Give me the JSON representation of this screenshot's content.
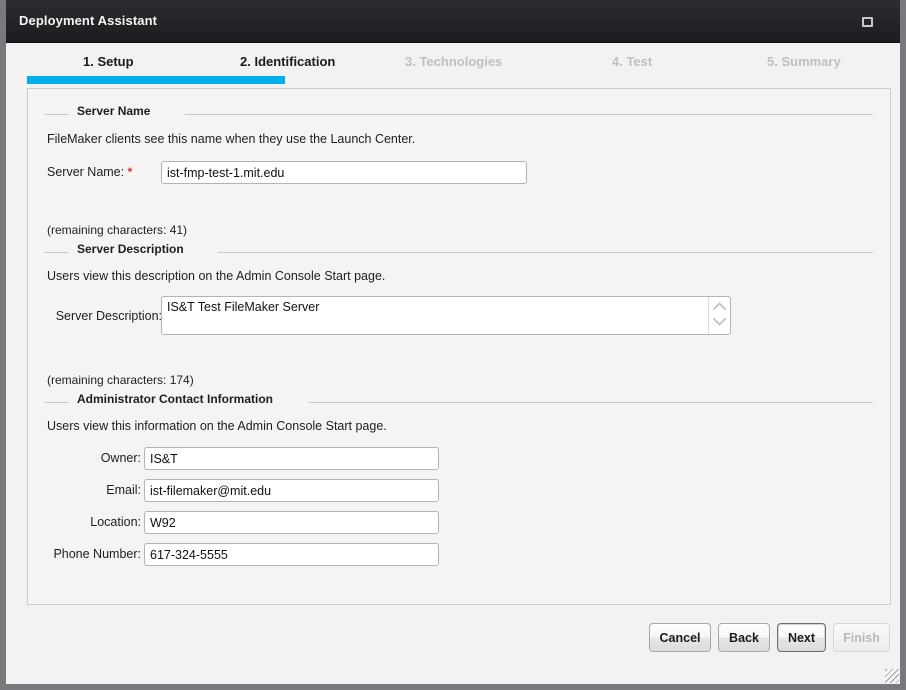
{
  "window": {
    "title": "Deployment Assistant",
    "maximize_icon": "maximize-box-icon",
    "resize_grip_icon": "resize-grip-icon",
    "accent_color": "#00b0e8",
    "titlebar_color": "#232528"
  },
  "steps": {
    "items": [
      {
        "label": "1. Setup",
        "state": "done"
      },
      {
        "label": "2. Identification",
        "state": "active"
      },
      {
        "label": "3. Technologies",
        "state": "upcoming"
      },
      {
        "label": "4. Test",
        "state": "upcoming"
      },
      {
        "label": "5. Summary",
        "state": "upcoming"
      }
    ],
    "progress_percent": 30
  },
  "sections": {
    "server_name": {
      "group_label": "Server Name",
      "help_text": "FileMaker clients see this name when they use the Launch Center.",
      "field_label": "Server Name:",
      "required_marker": "*",
      "value": "ist-fmp-test-1.mit.edu",
      "placeholder": "",
      "char_count": "(remaining characters: 41)"
    },
    "server_description": {
      "group_label": "Server Description",
      "help_text": "Users view this description on the Admin Console Start page.",
      "field_label": "Server Description:",
      "value": "IS&T Test FileMaker Server",
      "placeholder": "",
      "char_count": "(remaining characters: 174)",
      "scroll_up_icon": "chevron-up-icon",
      "scroll_down_icon": "chevron-down-icon"
    },
    "admin_contact": {
      "group_label": "Administrator Contact Information",
      "help_text": "Users view this information on the Admin Console Start page.",
      "fields": [
        {
          "label": "Owner:",
          "value": "IS&T",
          "placeholder": ""
        },
        {
          "label": "Email:",
          "value": "ist-filemaker@mit.edu",
          "placeholder": ""
        },
        {
          "label": "Location:",
          "value": "W92",
          "placeholder": ""
        },
        {
          "label": "Phone Number:",
          "value": "617-324-5555",
          "placeholder": ""
        }
      ]
    }
  },
  "footer": {
    "cancel_label": "Cancel",
    "back_label": "Back",
    "next_label": "Next",
    "finish_label": "Finish"
  }
}
